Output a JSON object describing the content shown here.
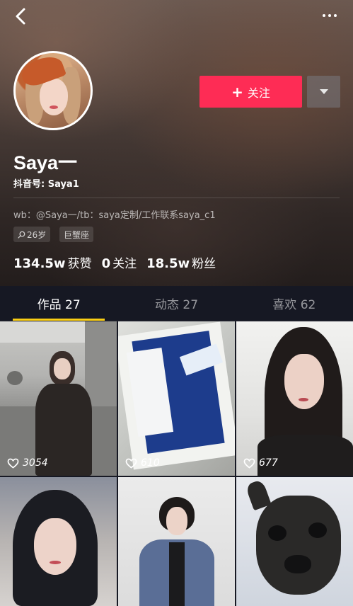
{
  "profile": {
    "name": "Saya一",
    "douyin_id": "抖音号: Saya1",
    "bio": "wb：@Saya一/tb：saya定制/工作联系saya_c1",
    "age_tag": "26岁",
    "zodiac_tag": "巨蟹座",
    "follow_label": "关注"
  },
  "stats": [
    {
      "num": "134.5w",
      "label": "获赞"
    },
    {
      "num": "0",
      "label": "关注"
    },
    {
      "num": "18.5w",
      "label": "粉丝"
    }
  ],
  "tabs": [
    {
      "label": "作品 27",
      "active": true
    },
    {
      "label": "动态 27",
      "active": false
    },
    {
      "label": "喜欢 62",
      "active": false
    }
  ],
  "videos": [
    {
      "likes": "3054"
    },
    {
      "likes": "610"
    },
    {
      "likes": "677"
    },
    {
      "likes": ""
    },
    {
      "likes": ""
    },
    {
      "likes": ""
    }
  ],
  "colors": {
    "accent": "#fe2c55",
    "tab_indicator": "#face15",
    "background": "#161823"
  },
  "icons": {
    "back": "chevron-left-icon",
    "more": "ellipsis-icon",
    "dropdown": "caret-down-icon",
    "like": "heart-icon",
    "search": "search-icon"
  }
}
